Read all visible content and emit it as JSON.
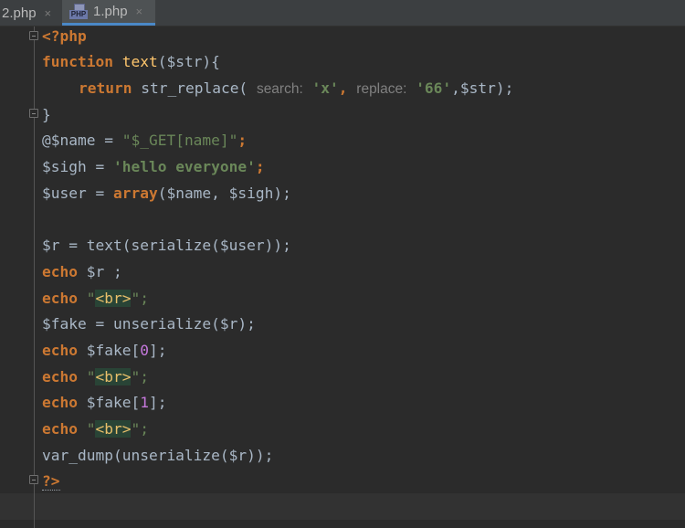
{
  "tabs": [
    {
      "label": "2.php",
      "close": "×"
    },
    {
      "label": "1.php",
      "close": "×",
      "icon_text": "PHP",
      "active": true
    }
  ],
  "code": {
    "l1": "<?php",
    "l2": {
      "kw": "function",
      "name": "text",
      "rest": "($str){"
    },
    "l3": {
      "kw": "return",
      "fn": "str_replace(",
      "hint1": "search:",
      "arg1": "'x'",
      "sep": ", ",
      "hint2": "replace:",
      "arg2": "'66'",
      "rest": ",$str);"
    },
    "l4": "}",
    "l5": {
      "pre": "@$name = ",
      "str": "\"$_GET[name]\"",
      "semi": ";"
    },
    "l6": {
      "pre": "$sigh = ",
      "str": "'hello everyone'",
      "semi": ";"
    },
    "l7": {
      "pre": "$user = ",
      "kw": "array",
      "rest": "($name, $sigh);"
    },
    "l8": "$r = text(serialize($user));",
    "l9": {
      "kw": "echo",
      "rest": " $r ;"
    },
    "l10": {
      "kw": "echo",
      "q1": " \"",
      "tag": "<br>",
      "q2": "\";"
    },
    "l11": "$fake = unserialize($r);",
    "l12": {
      "kw": "echo",
      "pre": " $fake[",
      "num": "0",
      "post": "];"
    },
    "l13": {
      "kw": "echo",
      "q1": " \"",
      "tag": "<br>",
      "q2": "\";"
    },
    "l14": {
      "kw": "echo",
      "pre": " $fake[",
      "num": "1",
      "post": "];"
    },
    "l15": {
      "kw": "echo",
      "q1": " \"",
      "tag": "<br>",
      "q2": "\";"
    },
    "l16": "var_dump(unserialize($r));",
    "l17": "?>"
  },
  "colors": {
    "background": "#2b2b2b",
    "keyword": "#cc7832",
    "function": "#ffc66d",
    "string": "#6a8759",
    "text": "#a9b7c6",
    "hint": "#808080"
  }
}
